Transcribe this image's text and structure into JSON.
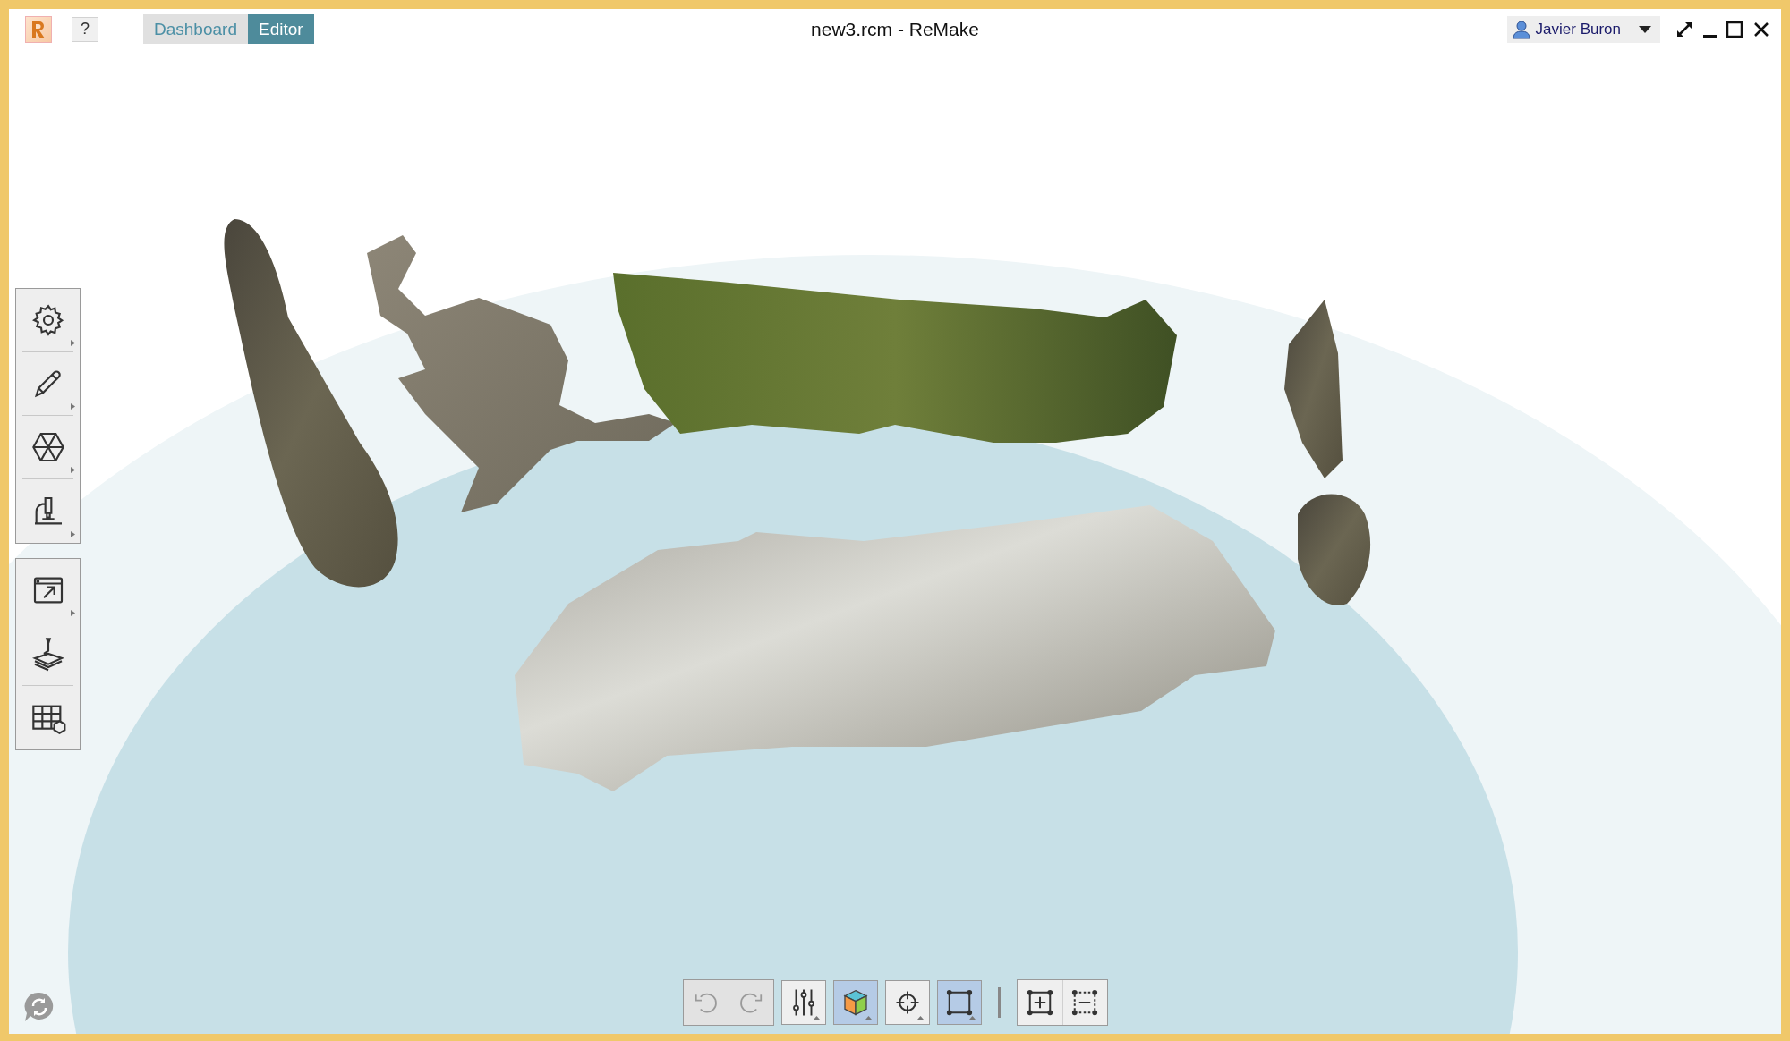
{
  "window": {
    "title": "new3.rcm - ReMake"
  },
  "help_button": {
    "label": "?"
  },
  "tabs": [
    {
      "label": "Dashboard",
      "selected": false
    },
    {
      "label": "Editor",
      "selected": true
    }
  ],
  "user": {
    "name": "Javier Buron"
  },
  "view_toolbar": [
    {
      "kind": "undo",
      "disabled": true
    },
    {
      "kind": "redo",
      "disabled": true
    },
    {
      "kind": "adjust",
      "selected": false
    },
    {
      "kind": "display-mode",
      "selected": true
    },
    {
      "kind": "pivot",
      "selected": false
    },
    {
      "kind": "frame",
      "selected": true
    },
    {
      "kind": "add-selection",
      "selected": false
    },
    {
      "kind": "remove-selection",
      "selected": false
    }
  ]
}
